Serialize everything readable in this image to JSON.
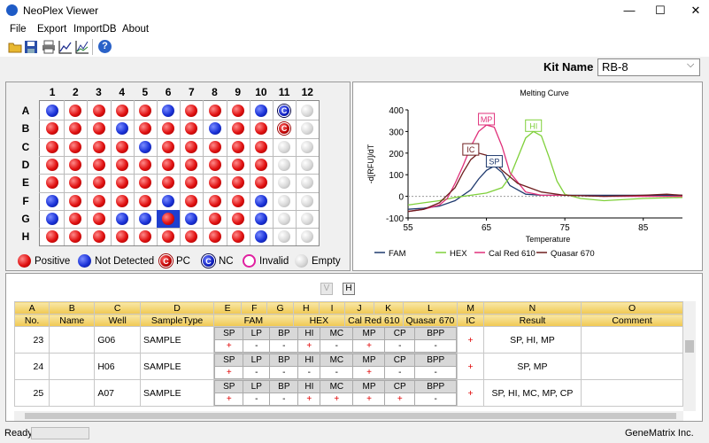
{
  "window": {
    "title": "NeoPlex Viewer",
    "minimize": "—",
    "maximize": "☐",
    "close": "✕"
  },
  "menu": [
    "File",
    "Export",
    "ImportDB",
    "About"
  ],
  "toolbar": [
    "open-icon",
    "save-icon",
    "print-icon",
    "line-chart-icon",
    "bar-chart-icon",
    "help-icon"
  ],
  "kit": {
    "label": "Kit Name",
    "value": "RB-8"
  },
  "plate": {
    "cols": [
      "1",
      "2",
      "3",
      "4",
      "5",
      "6",
      "7",
      "8",
      "9",
      "10",
      "11",
      "12"
    ],
    "rows": [
      "A",
      "B",
      "C",
      "D",
      "E",
      "F",
      "G",
      "H"
    ],
    "wells": [
      [
        "blue",
        "red",
        "red",
        "red",
        "red",
        "blue",
        "red",
        "red",
        "red",
        "blue",
        "nc",
        "gray"
      ],
      [
        "red",
        "red",
        "red",
        "blue",
        "red",
        "red",
        "red",
        "blue",
        "red",
        "red",
        "pc",
        "gray"
      ],
      [
        "red",
        "red",
        "red",
        "red",
        "blue",
        "red",
        "red",
        "red",
        "red",
        "red",
        "gray",
        "gray"
      ],
      [
        "red",
        "red",
        "red",
        "red",
        "red",
        "red",
        "red",
        "red",
        "red",
        "red",
        "gray",
        "gray"
      ],
      [
        "red",
        "red",
        "red",
        "red",
        "red",
        "red",
        "red",
        "red",
        "red",
        "red",
        "gray",
        "gray"
      ],
      [
        "blue",
        "red",
        "red",
        "red",
        "red",
        "blue",
        "red",
        "red",
        "red",
        "blue",
        "gray",
        "gray"
      ],
      [
        "blue",
        "red",
        "red",
        "blue",
        "blue",
        "sel",
        "blue",
        "red",
        "red",
        "blue",
        "gray",
        "gray"
      ],
      [
        "red",
        "red",
        "red",
        "red",
        "red",
        "red",
        "red",
        "red",
        "red",
        "blue",
        "gray",
        "gray"
      ]
    ],
    "pc_letter": "C",
    "nc_letter": "C"
  },
  "legend": {
    "positive": "Positive",
    "not_detected": "Not Detected",
    "pc": "PC",
    "nc": "NC",
    "invalid": "Invalid",
    "empty": "Empty"
  },
  "chart_data": {
    "type": "line",
    "title": "Melting Curve",
    "xlabel": "Temperature",
    "ylabel": "-d[RFU]/dT",
    "xlim": [
      55,
      90
    ],
    "ylim": [
      -100,
      400
    ],
    "xticks": [
      "55",
      "65",
      "75",
      "85"
    ],
    "yticks": [
      "-100",
      "0",
      "100",
      "200",
      "300",
      "400"
    ],
    "series": [
      {
        "name": "FAM",
        "color": "#1f3a6e",
        "x": [
          55,
          57,
          59,
          61,
          63,
          64,
          65,
          66,
          67,
          68,
          70,
          72,
          75,
          78,
          85,
          90
        ],
        "y": [
          -60,
          -55,
          -45,
          -20,
          30,
          80,
          120,
          140,
          110,
          50,
          10,
          5,
          5,
          5,
          5,
          5
        ]
      },
      {
        "name": "HEX",
        "color": "#7fd03a",
        "x": [
          55,
          57,
          59,
          61,
          63,
          65,
          67,
          68,
          69,
          70,
          71,
          72,
          73,
          74,
          75,
          77,
          80,
          85,
          90
        ],
        "y": [
          -40,
          -30,
          -20,
          -5,
          5,
          15,
          40,
          90,
          180,
          270,
          300,
          280,
          180,
          70,
          10,
          -10,
          -20,
          -10,
          -5
        ]
      },
      {
        "name": "Cal Red 610",
        "color": "#e0307a",
        "x": [
          55,
          57,
          59,
          60,
          61,
          62,
          63,
          64,
          65,
          66,
          67,
          68,
          70,
          72,
          75,
          80,
          90
        ],
        "y": [
          -70,
          -60,
          -40,
          -10,
          60,
          140,
          230,
          300,
          330,
          320,
          230,
          110,
          20,
          5,
          5,
          0,
          0
        ]
      },
      {
        "name": "Quasar 670",
        "color": "#6e1e1e",
        "x": [
          55,
          57,
          59,
          61,
          62,
          63,
          64,
          65,
          66,
          67,
          69,
          72,
          75,
          80,
          85,
          88,
          90
        ],
        "y": [
          -70,
          -60,
          -30,
          40,
          110,
          170,
          200,
          190,
          160,
          120,
          60,
          20,
          5,
          0,
          5,
          10,
          5
        ]
      }
    ],
    "annotations": [
      {
        "text": "MP",
        "x": 65,
        "y": 355,
        "color": "#e0307a"
      },
      {
        "text": "HI",
        "x": 71,
        "y": 325,
        "color": "#7fd03a"
      },
      {
        "text": "IC",
        "x": 63,
        "y": 215,
        "color": "#6e1e1e"
      },
      {
        "text": "SP",
        "x": 66,
        "y": 160,
        "color": "#1f3a6e"
      }
    ],
    "legend_position": "bottom"
  },
  "bottom": {
    "v_button": "V",
    "h_button": "H"
  },
  "table": {
    "col_letters": [
      "A",
      "B",
      "C",
      "D",
      "E",
      "F",
      "G",
      "H",
      "I",
      "J",
      "K",
      "L",
      "M",
      "N",
      "O"
    ],
    "headers": {
      "no": "No.",
      "name": "Name",
      "well": "Well",
      "sample_type": "SampleType",
      "fam": "FAM",
      "hex": "HEX",
      "calred": "Cal Red 610",
      "quasar": "Quasar 670",
      "ic": "IC",
      "result": "Result",
      "comment": "Comment"
    },
    "rows": [
      {
        "no": "23",
        "name": "",
        "well": "G06",
        "type": "SAMPLE",
        "ic": "+",
        "result": "SP, HI, MP",
        "comment": "",
        "sub_labels": [
          "SP",
          "LP",
          "BP",
          "HI",
          "MC",
          "MP",
          "CP",
          "BPP"
        ],
        "sub_vals": [
          "+",
          "-",
          "-",
          "+",
          "-",
          "+",
          "-",
          "-"
        ]
      },
      {
        "no": "24",
        "name": "",
        "well": "H06",
        "type": "SAMPLE",
        "ic": "+",
        "result": "SP, MP",
        "comment": "",
        "sub_labels": [
          "SP",
          "LP",
          "BP",
          "HI",
          "MC",
          "MP",
          "CP",
          "BPP"
        ],
        "sub_vals": [
          "+",
          "-",
          "-",
          "-",
          "-",
          "+",
          "-",
          "-"
        ]
      },
      {
        "no": "25",
        "name": "",
        "well": "A07",
        "type": "SAMPLE",
        "ic": "+",
        "result": "SP, HI, MC, MP, CP",
        "comment": "",
        "sub_labels": [
          "SP",
          "LP",
          "BP",
          "HI",
          "MC",
          "MP",
          "CP",
          "BPP"
        ],
        "sub_vals": [
          "+",
          "-",
          "-",
          "+",
          "+",
          "+",
          "+",
          "-"
        ]
      }
    ]
  },
  "status": {
    "left": "Ready",
    "right": "GeneMatrix Inc."
  }
}
